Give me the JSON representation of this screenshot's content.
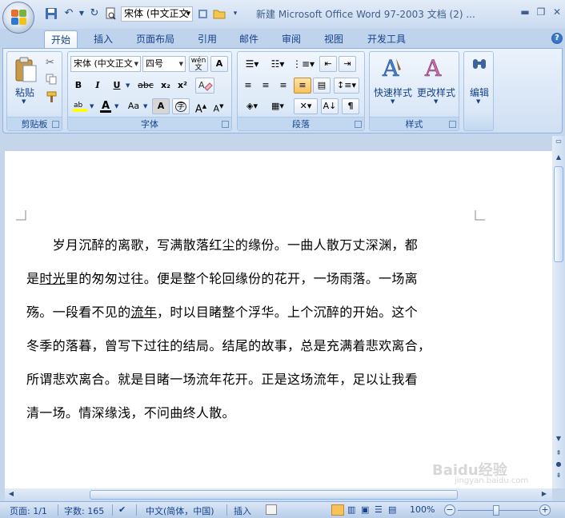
{
  "qat": {
    "font_box": "宋体 (中文正文"
  },
  "window_title": "新建 Microsoft Office Word 97-2003 文档 (2) ...",
  "tabs": [
    {
      "label": "开始",
      "active": true
    },
    {
      "label": "插入"
    },
    {
      "label": "页面布局"
    },
    {
      "label": "引用"
    },
    {
      "label": "邮件"
    },
    {
      "label": "审阅"
    },
    {
      "label": "视图"
    },
    {
      "label": "开发工具"
    }
  ],
  "ribbon": {
    "clipboard": {
      "paste_label": "粘贴",
      "group_label": "剪贴板"
    },
    "font": {
      "font_name": "宋体 (中文正文",
      "font_size": "四号",
      "bold": "B",
      "italic": "I",
      "underline": "U",
      "strike": "abc",
      "subscript": "x₂",
      "superscript": "x²",
      "font_color_letter": "A",
      "change_case": "Aa",
      "grow": "A",
      "shrink": "A",
      "enclose": "字",
      "wen": "wén",
      "group_label": "字体"
    },
    "paragraph": {
      "group_label": "段落"
    },
    "styles": {
      "quick_label": "快速样式",
      "change_label": "更改样式",
      "group_label": "样式"
    },
    "editing": {
      "label": "编辑"
    }
  },
  "document": {
    "lines": [
      [
        "　　岁月沉醉的离歌，写满散落红尘的缘份。一曲人散万丈深渊，都"
      ],
      [
        "是",
        {
          "u": "时光"
        },
        "里的匆匆过往。便是整个轮回缘份的花开，一场雨落。一场离"
      ],
      [
        "殇。一段看不见的",
        {
          "u": "流年"
        },
        "，时以目睹整个浮华。上个沉醉的开始。这个"
      ],
      [
        "冬季的落暮，曾写下过往的结局。结尾的故事，总是充满着悲欢离合，"
      ],
      [
        "所谓悲欢离合。就是目睹一场流年花开。正是这场流年，足以让我看"
      ],
      [
        "清一场。情深缘浅，不问曲终人散。"
      ]
    ]
  },
  "status": {
    "page": "页面: 1/1",
    "words": "字数: 165",
    "language": "中文(简体，中国)",
    "mode": "插入",
    "zoom": "100%"
  },
  "watermark": {
    "text": "Baidu经验",
    "sub": "jingyan.baidu.com"
  },
  "colors": {
    "accent": "#15428b",
    "ribbon_bg": "#dbe8f7",
    "active_paragraph": "#f8c15a"
  }
}
